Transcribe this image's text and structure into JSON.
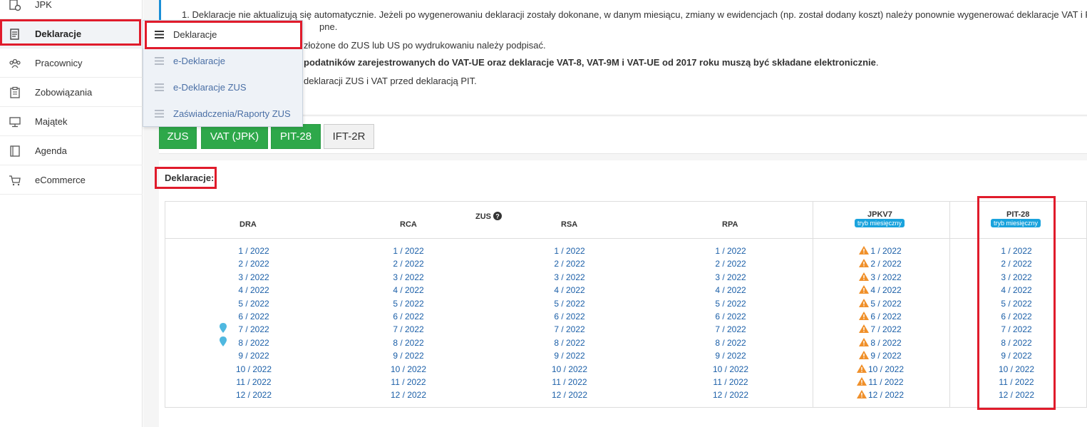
{
  "sidebar": {
    "items": [
      {
        "label": "JPK",
        "icon": "jpk-icon"
      },
      {
        "label": "Deklaracje",
        "icon": "declarations-icon"
      },
      {
        "label": "Pracownicy",
        "icon": "employees-icon"
      },
      {
        "label": "Zobowiązania",
        "icon": "obligations-icon"
      },
      {
        "label": "Majątek",
        "icon": "assets-icon"
      },
      {
        "label": "Agenda",
        "icon": "agenda-icon"
      },
      {
        "label": "eCommerce",
        "icon": "cart-icon"
      }
    ]
  },
  "dropdown": {
    "items": [
      {
        "label": "Deklaracje"
      },
      {
        "label": "e-Deklaracje"
      },
      {
        "label": "e-Deklaracje ZUS"
      },
      {
        "label": "Zaświadczenia/Raporty ZUS"
      }
    ]
  },
  "info": {
    "line1": "1. Deklaracje nie aktualizują się automatycznie. Jeżeli po wygenerowaniu deklaracji zostały dokonane, w danym miesiącu, zmiany w ewidencjach (np. został dodany koszt) należy ponownie wygenerować deklaracje VAT i P",
    "line1b": "pne.",
    "line2": "złożone do ZUS lub US po wydrukowaniu należy podpisać.",
    "line3": "podatników zarejestrowanych do VAT-UE oraz deklaracje VAT-8, VAT-9M i VAT-UE od 2017 roku muszą być składane elektronicznie",
    "line3_end": ".",
    "line4": "deklaracji ZUS i VAT przed deklaracją PIT."
  },
  "tabs": [
    "ZUS",
    "VAT (JPK)",
    "PIT-28",
    "IFT-2R"
  ],
  "declarations": {
    "title": "Deklaracje:",
    "zus_group_label": "ZUS",
    "columns": [
      {
        "key": "dra",
        "header": "DRA"
      },
      {
        "key": "rca",
        "header": "RCA"
      },
      {
        "key": "rsa",
        "header": "RSA"
      },
      {
        "key": "rpa",
        "header": "RPA"
      },
      {
        "key": "jpkv7",
        "header": "JPKV7",
        "badge": "tryb miesięczny"
      },
      {
        "key": "pit28",
        "header": "PIT-28",
        "badge": "tryb miesięczny"
      }
    ],
    "periods": [
      "1 / 2022",
      "2 / 2022",
      "3 / 2022",
      "4 / 2022",
      "5 / 2022",
      "6 / 2022",
      "7 / 2022",
      "8 / 2022",
      "9 / 2022",
      "10 / 2022",
      "11 / 2022",
      "12 / 2022"
    ],
    "jpk_periods": [
      "1 / 2022",
      "2 / 2022",
      "3 / 2022",
      "4 / 2022",
      "5 / 2022",
      "6 / 2022",
      "7 / 2022",
      "8 / 2022",
      "9 / 2022",
      "10 / 2022",
      "11 / 2022",
      "12 / 2022"
    ]
  },
  "colors": {
    "accent_blue": "#1b8fd6",
    "link": "#1b5fa8",
    "tab_green": "#2ea84a",
    "badge_blue": "#1aa3dd",
    "highlight_red": "#e01b2b",
    "warning_orange": "#f0902a"
  }
}
